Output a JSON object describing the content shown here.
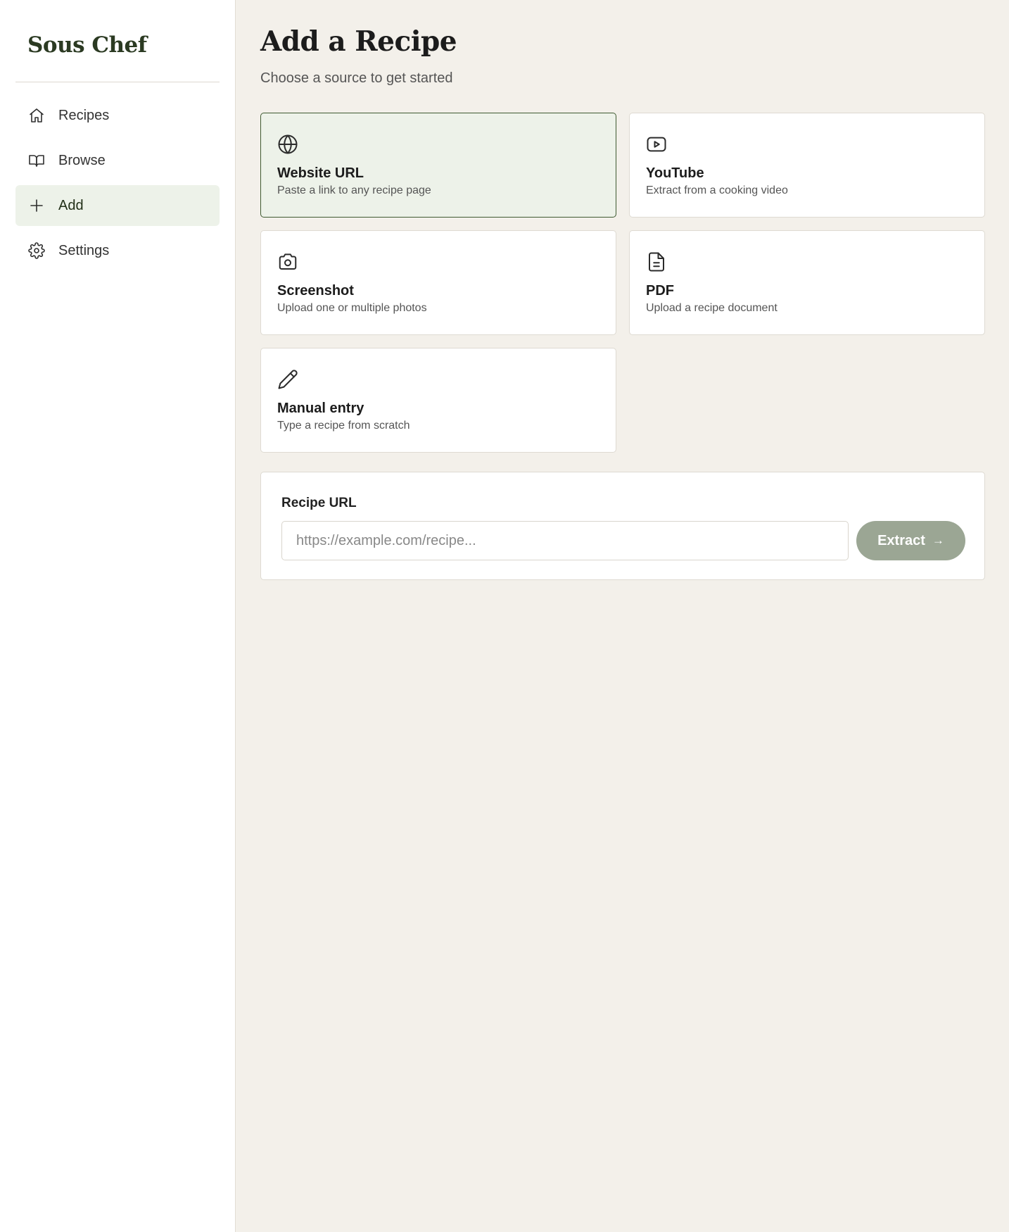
{
  "sidebar": {
    "brand": "Sous Chef",
    "items": [
      {
        "label": "Recipes",
        "icon": "home-icon",
        "active": false
      },
      {
        "label": "Browse",
        "icon": "book-icon",
        "active": false
      },
      {
        "label": "Add",
        "icon": "plus-icon",
        "active": true
      },
      {
        "label": "Settings",
        "icon": "gear-icon",
        "active": false
      }
    ]
  },
  "main": {
    "title": "Add a Recipe",
    "subtitle": "Choose a source to get started",
    "sources": [
      {
        "title": "Website URL",
        "description": "Paste a link to any recipe page",
        "icon": "globe-icon",
        "selected": true
      },
      {
        "title": "YouTube",
        "description": "Extract from a cooking video",
        "icon": "youtube-icon",
        "selected": false
      },
      {
        "title": "Screenshot",
        "description": "Upload one or multiple photos",
        "icon": "camera-icon",
        "selected": false
      },
      {
        "title": "PDF",
        "description": "Upload a recipe document",
        "icon": "document-icon",
        "selected": false
      },
      {
        "title": "Manual entry",
        "description": "Type a recipe from scratch",
        "icon": "pencil-icon",
        "selected": false
      }
    ],
    "url_form": {
      "label": "Recipe URL",
      "placeholder": "https://example.com/recipe...",
      "value": "",
      "button_label": "Extract",
      "button_icon": "arrow-right-icon"
    }
  },
  "colors": {
    "accent": "#3f5a31",
    "selected_bg": "#edf2e9",
    "page_bg": "#f3f0ea",
    "button_bg": "#9ba694"
  }
}
